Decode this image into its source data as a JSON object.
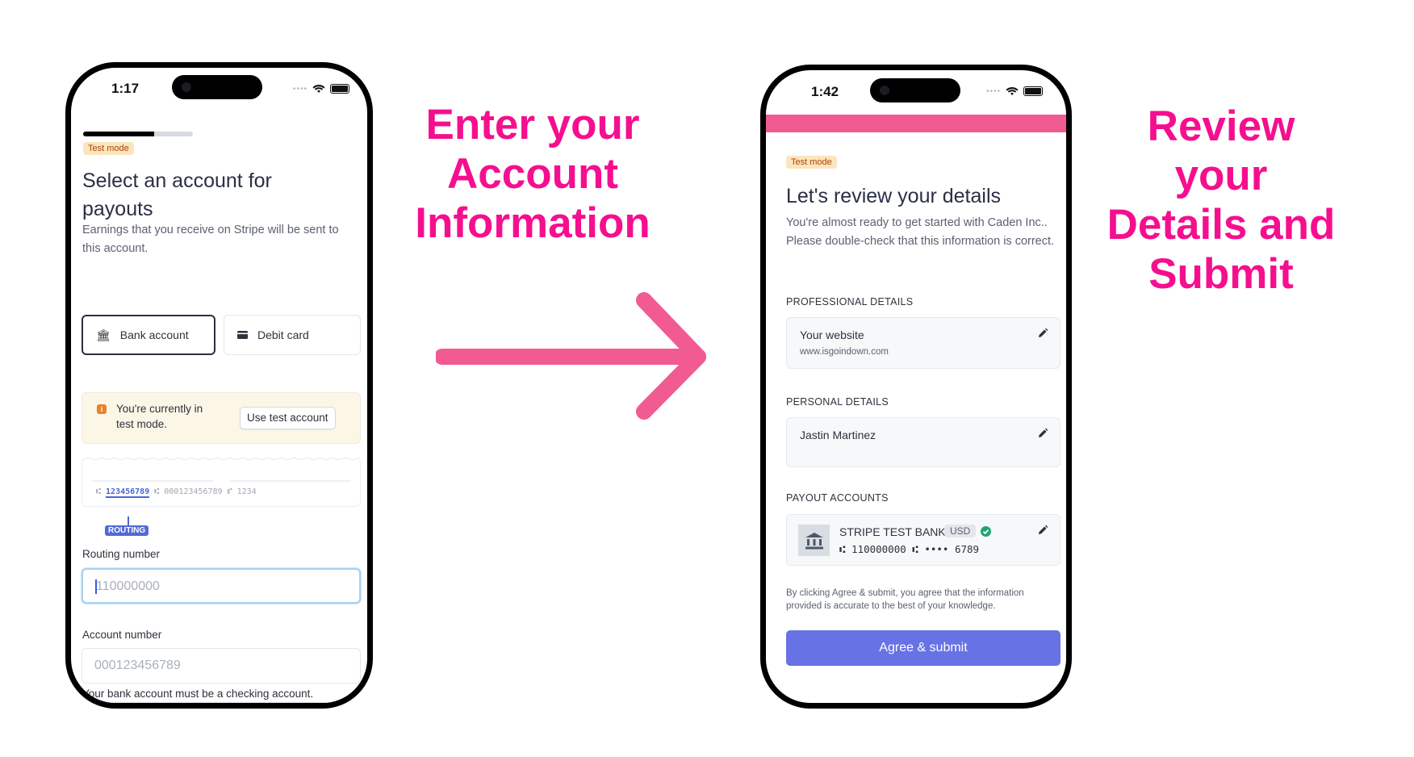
{
  "annotations": {
    "left_headline": [
      "Enter your",
      "Account",
      "Information"
    ],
    "right_headline": [
      "Review",
      "your",
      "Details and",
      "Submit"
    ],
    "arrow_color": "#f15b91",
    "headline_color": "#f50f8f"
  },
  "left_screen": {
    "status_bar": {
      "time": "1:17"
    },
    "progress_percent": 65,
    "test_mode_badge": "Test mode",
    "title": "Select an account for payouts",
    "subtitle": "Earnings that you receive on Stripe will be sent to this account.",
    "tabs": [
      {
        "label": "Bank account",
        "icon": "bank-icon",
        "selected": true
      },
      {
        "label": "Debit card",
        "icon": "card-icon",
        "selected": false
      }
    ],
    "alert": {
      "icon": "info-icon",
      "text": "You're currently in test mode.",
      "button": "Use test account"
    },
    "check_illustration": {
      "routing": "123456789",
      "account": "000123456789",
      "check_number": "1234",
      "tag": "ROUTING"
    },
    "routing_field": {
      "label": "Routing number",
      "placeholder": "110000000",
      "value": ""
    },
    "account_field": {
      "label": "Account number",
      "placeholder": "000123456789",
      "value": ""
    },
    "hint": "Your bank account must be a checking account."
  },
  "right_screen": {
    "status_bar": {
      "time": "1:42"
    },
    "accent_color": "#f15b91",
    "test_mode_badge": "Test mode",
    "title": "Let's review your details",
    "subtitle": "You're almost ready to get started with Caden Inc.. Please double-check that this information is correct.",
    "sections": {
      "professional": {
        "heading": "PROFESSIONAL DETAILS",
        "title": "Your website",
        "value": "www.isgoindown.com"
      },
      "personal": {
        "heading": "PERSONAL DETAILS",
        "name": "Jastin Martinez"
      },
      "payout": {
        "heading": "PAYOUT ACCOUNTS",
        "bank_name": "STRIPE TEST BANK",
        "currency": "USD",
        "routing": "110000000",
        "account_masked": "•••• 6789"
      }
    },
    "disclaimer": "By clicking Agree & submit, you agree that the information provided is accurate to the best of your knowledge.",
    "submit_button": "Agree & submit",
    "submit_color": "#6772e5"
  }
}
